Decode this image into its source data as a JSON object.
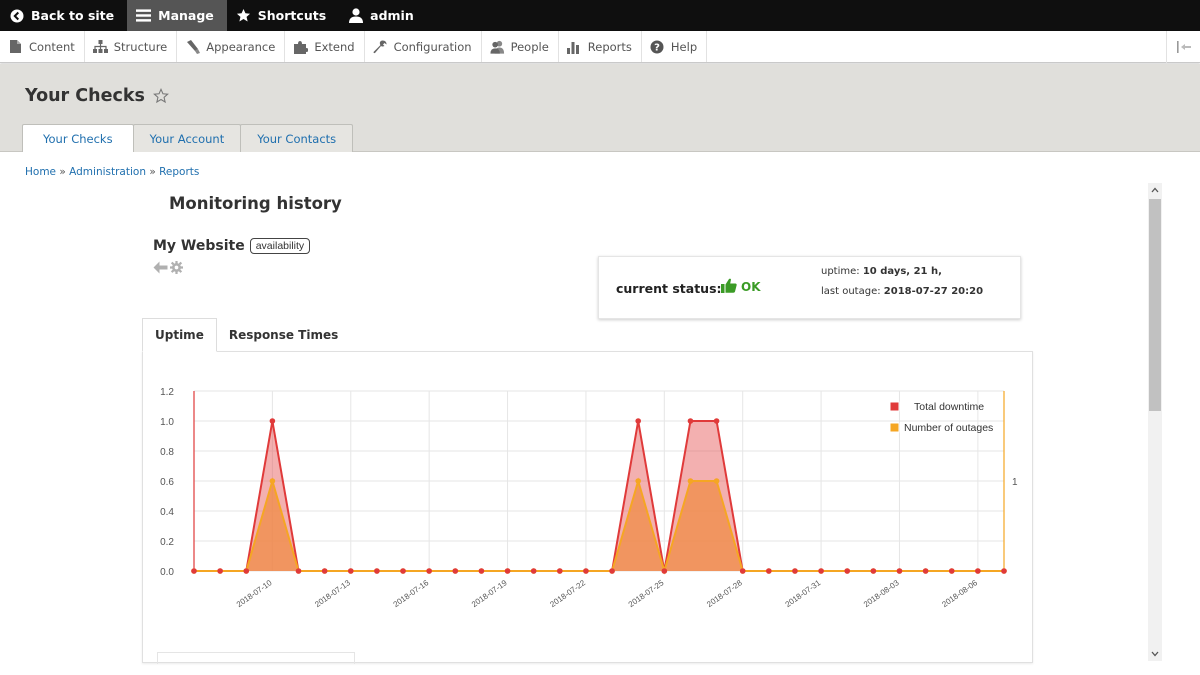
{
  "toolbar": {
    "back": "Back to site",
    "manage": "Manage",
    "shortcuts": "Shortcuts",
    "user": "admin"
  },
  "tray": {
    "items": [
      "Content",
      "Structure",
      "Appearance",
      "Extend",
      "Configuration",
      "People",
      "Reports",
      "Help"
    ]
  },
  "page": {
    "title": "Your Checks",
    "tabs": [
      "Your Checks",
      "Your Account",
      "Your Contacts"
    ],
    "breadcrumb": [
      "Home",
      "Administration",
      "Reports"
    ],
    "breadcrumb_sep": "»"
  },
  "content": {
    "title": "Monitoring history",
    "website": "My Website",
    "badge": "availability",
    "status_label": "current status:",
    "status_value": "OK",
    "uptime_label": "uptime:",
    "uptime_value": "10 days, 21 h,",
    "outage_label": "last outage:",
    "outage_value": "2018-07-27 20:20",
    "tabs": [
      "Uptime",
      "Response Times"
    ]
  },
  "colors": {
    "downtime": "#e03a3a",
    "outages": "#f5a623",
    "accent_link": "#1f6fae",
    "ok_green": "#3b9b26"
  },
  "chart_data": {
    "type": "area",
    "x": [
      "2018-07-07",
      "2018-07-08",
      "2018-07-09",
      "2018-07-10",
      "2018-07-11",
      "2018-07-12",
      "2018-07-13",
      "2018-07-14",
      "2018-07-15",
      "2018-07-16",
      "2018-07-17",
      "2018-07-18",
      "2018-07-19",
      "2018-07-20",
      "2018-07-21",
      "2018-07-22",
      "2018-07-23",
      "2018-07-24",
      "2018-07-25",
      "2018-07-26",
      "2018-07-27",
      "2018-07-28",
      "2018-07-29",
      "2018-07-30",
      "2018-07-31",
      "2018-08-01",
      "2018-08-02",
      "2018-08-03",
      "2018-08-04",
      "2018-08-05",
      "2018-08-06",
      "2018-08-07"
    ],
    "x_tick_labels": [
      "2018-07-10",
      "2018-07-13",
      "2018-07-16",
      "2018-07-19",
      "2018-07-22",
      "2018-07-25",
      "2018-07-28",
      "2018-07-31",
      "2018-08-03",
      "2018-08-06"
    ],
    "series": [
      {
        "name": "Total downtime",
        "values": [
          0,
          0,
          0,
          1,
          0,
          0,
          0,
          0,
          0,
          0,
          0,
          0,
          0,
          0,
          0,
          0,
          0,
          1,
          0,
          1,
          1,
          0,
          0,
          0,
          0,
          0,
          0,
          0,
          0,
          0,
          0,
          0
        ]
      },
      {
        "name": "Number of outages",
        "values": [
          0,
          0,
          0,
          0.6,
          0,
          0,
          0,
          0,
          0,
          0,
          0,
          0,
          0,
          0,
          0,
          0,
          0,
          0.6,
          0,
          0.6,
          0.6,
          0,
          0,
          0,
          0,
          0,
          0,
          0,
          0,
          0,
          0,
          0
        ]
      }
    ],
    "y_ticks": [
      "0.0",
      "0.2",
      "0.4",
      "0.6",
      "0.8",
      "1.0",
      "1.2"
    ],
    "ylim": [
      0,
      1.2
    ],
    "right_axis_label": "1",
    "legend_position": "top-right",
    "grid": true
  }
}
